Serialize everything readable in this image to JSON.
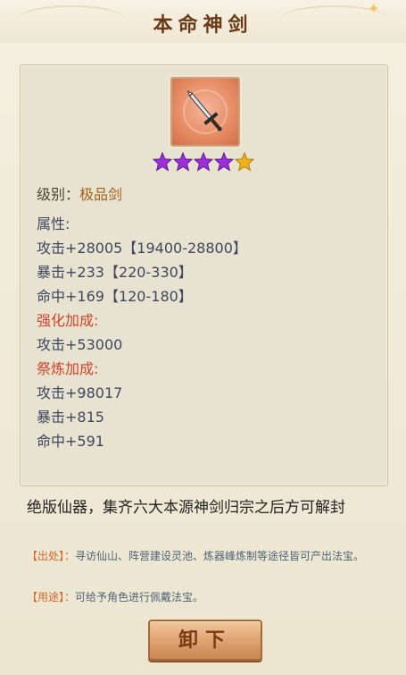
{
  "title": "本命神剑",
  "colors": {
    "title": "#6a3a16",
    "red_heading": "#d1432b",
    "value_gold": "#a2621b",
    "star_purple": "#9b2fd8",
    "star_gold": "#f0b21c"
  },
  "item": {
    "icon": "sword-icon",
    "stars": {
      "total": 5,
      "purple": 4,
      "gold": 1
    },
    "level_label": "级别：",
    "level_value": "极品剑",
    "attributes_heading": "属性:",
    "attributes": [
      "攻击+28005【19400-28800】",
      "暴击+233【220-330】",
      "命中+169【120-180】"
    ],
    "enhance_heading": "强化加成:",
    "enhance": [
      "攻击+53000"
    ],
    "refine_heading": "祭炼加成:",
    "refine": [
      "攻击+98017",
      "暴击+815",
      "命中+591"
    ]
  },
  "description": "绝版仙器，集齐六大本源神剑归宗之后方可解封",
  "source": {
    "tag": "【出处】：",
    "text": "寻访仙山、阵营建设灵池、炼器峰炼制等途径皆可产出法宝。"
  },
  "usage": {
    "tag": "【用途】：",
    "text": "可给予角色进行佩戴法宝。"
  },
  "button_label": "卸下"
}
